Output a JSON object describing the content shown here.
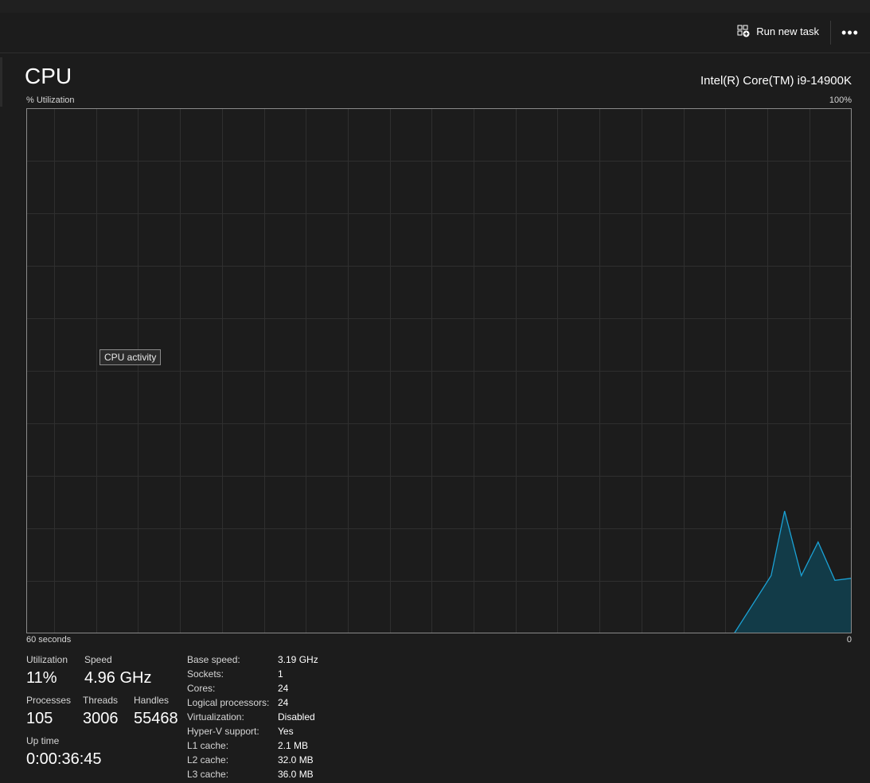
{
  "toolbar": {
    "run_new_task_label": "Run new task",
    "more_label": "•••"
  },
  "header": {
    "title": "CPU",
    "cpu_model": "Intel(R) Core(TM) i9-14900K"
  },
  "graph": {
    "y_label": "% Utilization",
    "y_max_label": "100%",
    "x_left_label": "60 seconds",
    "x_right_label": "0",
    "tooltip": "CPU activity"
  },
  "chart_data": {
    "type": "area",
    "x_range": [
      60,
      0
    ],
    "ylim": [
      0,
      100
    ],
    "grid": true,
    "x": [
      0,
      2.2,
      3,
      4,
      5,
      6,
      7
    ],
    "values": [
      0,
      11,
      23.3,
      11,
      17.4,
      10.1,
      10.5
    ],
    "line_color": "#1ba1d4",
    "fill_color": "#123b48"
  },
  "stats": {
    "utilization": {
      "label": "Utilization",
      "value": "11%"
    },
    "speed": {
      "label": "Speed",
      "value": "4.96 GHz"
    },
    "processes": {
      "label": "Processes",
      "value": "105"
    },
    "threads": {
      "label": "Threads",
      "value": "3006"
    },
    "handles": {
      "label": "Handles",
      "value": "55468"
    },
    "uptime": {
      "label": "Up time",
      "value": "0:00:36:45"
    }
  },
  "specs": [
    {
      "key": "Base speed:",
      "value": "3.19 GHz"
    },
    {
      "key": "Sockets:",
      "value": "1"
    },
    {
      "key": "Cores:",
      "value": "24"
    },
    {
      "key": "Logical processors:",
      "value": "24"
    },
    {
      "key": "Virtualization:",
      "value": "Disabled"
    },
    {
      "key": "Hyper-V support:",
      "value": "Yes"
    },
    {
      "key": "L1 cache:",
      "value": "2.1 MB"
    },
    {
      "key": "L2 cache:",
      "value": "32.0 MB"
    },
    {
      "key": "L3 cache:",
      "value": "36.0 MB"
    }
  ],
  "colors": {
    "background": "#1c1c1c",
    "grid": "#2f2f2f",
    "border": "#8a8a8a",
    "accent": "#1ba1d4"
  }
}
